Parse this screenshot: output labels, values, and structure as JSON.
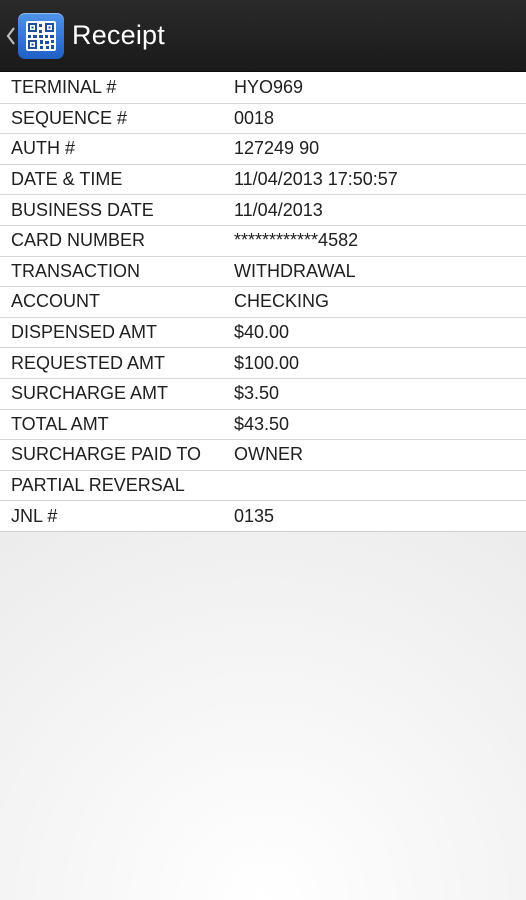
{
  "action_bar": {
    "title": "Receipt",
    "up_icon": "chevron-left-icon",
    "app_icon": "qr-code-icon",
    "background": "#1e1e1e",
    "app_icon_color": "#2f78d8"
  },
  "receipt": {
    "rows": [
      {
        "label": "TERMINAL #",
        "value": "HYO969"
      },
      {
        "label": "SEQUENCE #",
        "value": "0018"
      },
      {
        "label": "AUTH #",
        "value": "127249 90"
      },
      {
        "label": "DATE & TIME",
        "value": "11/04/2013 17:50:57"
      },
      {
        "label": "BUSINESS DATE",
        "value": "11/04/2013"
      },
      {
        "label": "CARD NUMBER",
        "value": "************4582"
      },
      {
        "label": "TRANSACTION",
        "value": "WITHDRAWAL"
      },
      {
        "label": "ACCOUNT",
        "value": "CHECKING"
      },
      {
        "label": "DISPENSED AMT",
        "value": "$40.00"
      },
      {
        "label": "REQUESTED AMT",
        "value": "$100.00"
      },
      {
        "label": "SURCHARGE AMT",
        "value": "$3.50"
      },
      {
        "label": "TOTAL AMT",
        "value": "$43.50"
      },
      {
        "label": "SURCHARGE PAID TO",
        "value": "OWNER"
      },
      {
        "label": "PARTIAL REVERSAL",
        "value": ""
      },
      {
        "label": "JNL #",
        "value": "0135"
      }
    ]
  }
}
